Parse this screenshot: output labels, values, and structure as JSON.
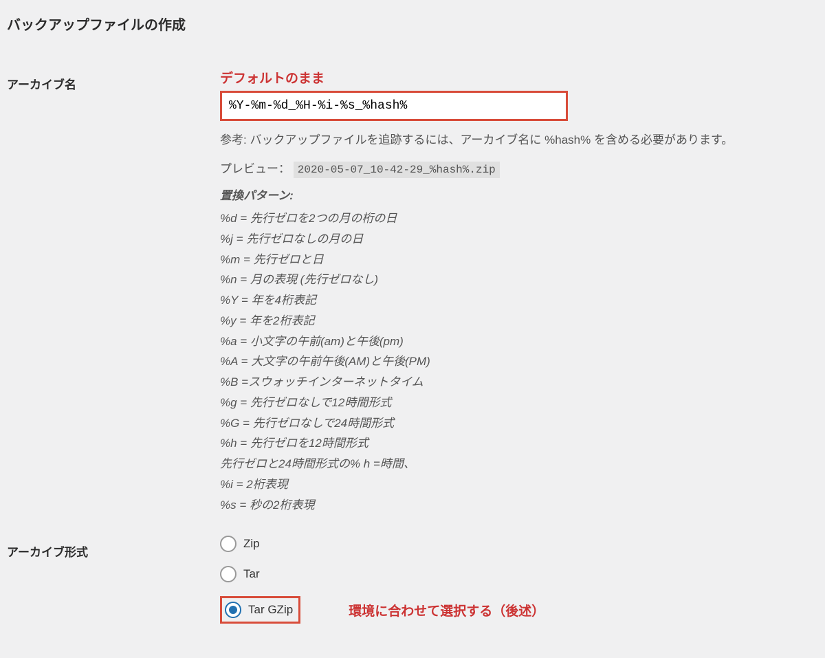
{
  "section_title": "バックアップファイルの作成",
  "archive_name": {
    "label": "アーカイブ名",
    "annotation": "デフォルトのまま",
    "input_value": "%Y-%m-%d_%H-%i-%s_%hash%",
    "help_text": "参考: バックアップファイルを追跡するには、アーカイブ名に %hash% を含める必要があります。",
    "preview_label": "プレビュー：",
    "preview_value": "2020-05-07_10-42-29_%hash%.zip",
    "pattern_header": "置換パターン:",
    "patterns": [
      "%d = 先行ゼロを2つの月の桁の日",
      "%j = 先行ゼロなしの月の日",
      "%m = 先行ゼロと日",
      "%n = 月の表現 (先行ゼロなし)",
      "%Y = 年を4桁表記",
      "%y = 年を2桁表記",
      "%a = 小文字の午前(am)と午後(pm)",
      "%A = 大文字の午前午後(AM)と午後(PM)",
      "%B =スウォッチインターネットタイム",
      "%g = 先行ゼロなしで12時間形式",
      "%G = 先行ゼロなしで24時間形式",
      "%h = 先行ゼロを12時間形式",
      "先行ゼロと24時間形式の% h =時間、",
      "%i = 2桁表現",
      "%s = 秒の2桁表現"
    ]
  },
  "archive_format": {
    "label": "アーカイブ形式",
    "options": [
      {
        "label": "Zip",
        "checked": false
      },
      {
        "label": "Tar",
        "checked": false
      },
      {
        "label": "Tar GZip",
        "checked": true
      }
    ],
    "annotation": "環境に合わせて選択する（後述）"
  }
}
